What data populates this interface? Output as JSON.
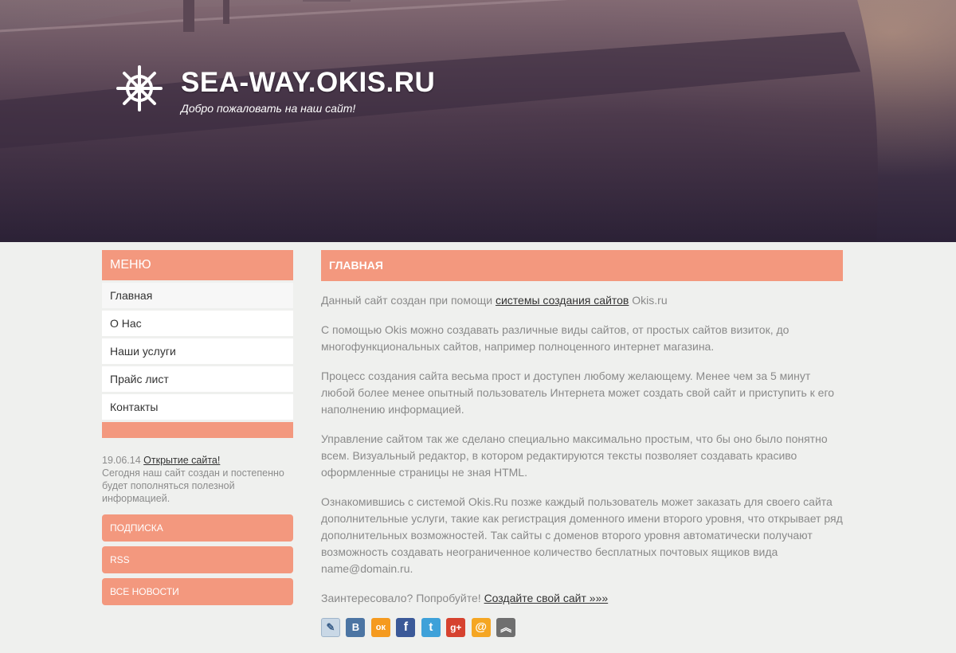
{
  "header": {
    "title": "SEA-WAY.OKIS.RU",
    "slogan": "Добро пожаловать на наш сайт!"
  },
  "sidebar": {
    "menu_title": "МЕНЮ",
    "items": [
      {
        "label": "Главная"
      },
      {
        "label": "О Нас"
      },
      {
        "label": "Наши услуги"
      },
      {
        "label": "Прайс лист"
      },
      {
        "label": "Контакты"
      }
    ],
    "news": {
      "date": "19.06.14",
      "title": "Открытие сайта!",
      "text": "Сегодня наш сайт создан и постепенно будет пополняться полезной информацией."
    },
    "buttons": [
      {
        "label": "ПОДПИСКА"
      },
      {
        "label": "RSS"
      },
      {
        "label": "ВСЕ НОВОСТИ"
      }
    ]
  },
  "main": {
    "heading": "ГЛАВНАЯ",
    "p1": {
      "before": "Данный сайт создан при помощи ",
      "link": "системы создания сайтов",
      "after": " Okis.ru"
    },
    "p2": "С помощью Okis можно создавать различные виды сайтов, от простых сайтов визиток, до многофункциональных сайтов, например полноценного интернет магазина.",
    "p3": "Процесс создания сайта весьма прост и доступен любому желающему. Менее чем за 5 минут любой более менее опытный пользователь Интернета может создать свой сайт и приступить к его наполнению информацией.",
    "p4": "Управление сайтом так же сделано специально максимально простым, что бы оно было понятно всем. Визуальный редактор, в котором редактируются тексты позволяет создавать красиво оформленные страницы не зная HTML.",
    "p5": "Ознакомившись с системой Okis.Ru позже каждый пользователь может заказать для своего сайта дополнительные услуги, такие как регистрация доменного имени второго уровня, что открывает ряд дополнительных возможностей. Так сайты с доменов второго уровня автоматически получают возможность создавать неограниченное количество бесплатных почтовых ящиков вида name@domain.ru.",
    "p6": {
      "before": "Заинтересовало? Попробуйте! ",
      "link": "Создайте свой сайт »»»"
    },
    "share": [
      {
        "name": "livejournal",
        "glyph": "✎",
        "color": "#c9d8e6"
      },
      {
        "name": "vkontakte",
        "glyph": "В",
        "color": "#4c75a3"
      },
      {
        "name": "odnoklassniki",
        "glyph": "ок",
        "color": "#f59a1f"
      },
      {
        "name": "facebook",
        "glyph": "f",
        "color": "#3b5998"
      },
      {
        "name": "twitter",
        "glyph": "t",
        "color": "#3ea1d9"
      },
      {
        "name": "google-plus",
        "glyph": "g+",
        "color": "#d6422f"
      },
      {
        "name": "mail-ru",
        "glyph": "@",
        "color": "#f5a623"
      },
      {
        "name": "surfingbird",
        "glyph": "︽",
        "color": "#6f6f6f"
      }
    ]
  }
}
